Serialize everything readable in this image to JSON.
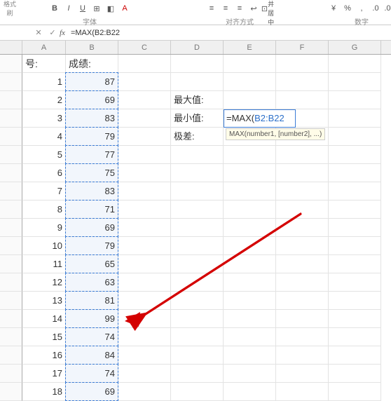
{
  "ribbon": {
    "format_painter": "格式刷",
    "bold": "B",
    "italic": "I",
    "underline": "U",
    "group_font": "字体",
    "group_align": "对齐方式",
    "group_number": "数字",
    "merge": "合并居中"
  },
  "formula_bar": {
    "fx": "fx",
    "value": "=MAX(B2:B22"
  },
  "columns": [
    "A",
    "B",
    "C",
    "D",
    "E",
    "F",
    "G"
  ],
  "header_row": {
    "A": "号:",
    "B": "成绩:"
  },
  "dataA": [
    "1",
    "2",
    "3",
    "4",
    "5",
    "6",
    "7",
    "8",
    "9",
    "10",
    "11",
    "12",
    "13",
    "14",
    "15",
    "16",
    "17",
    "18"
  ],
  "dataB": [
    "87",
    "69",
    "83",
    "79",
    "77",
    "75",
    "83",
    "71",
    "69",
    "79",
    "65",
    "63",
    "81",
    "99",
    "74",
    "84",
    "74",
    "69"
  ],
  "labels": {
    "max": "最大值:",
    "min": "最小值:",
    "range": "极差:"
  },
  "editing_formula": {
    "prefix": "=MAX(",
    "ref": "B2:B22"
  },
  "tooltip": "MAX(number1, [number2], ...)",
  "chart_data": {
    "type": "table",
    "title": "成绩",
    "categories": [
      "1",
      "2",
      "3",
      "4",
      "5",
      "6",
      "7",
      "8",
      "9",
      "10",
      "11",
      "12",
      "13",
      "14",
      "15",
      "16",
      "17",
      "18"
    ],
    "values": [
      87,
      69,
      83,
      79,
      77,
      75,
      83,
      71,
      69,
      79,
      65,
      63,
      81,
      99,
      74,
      84,
      74,
      69
    ]
  }
}
